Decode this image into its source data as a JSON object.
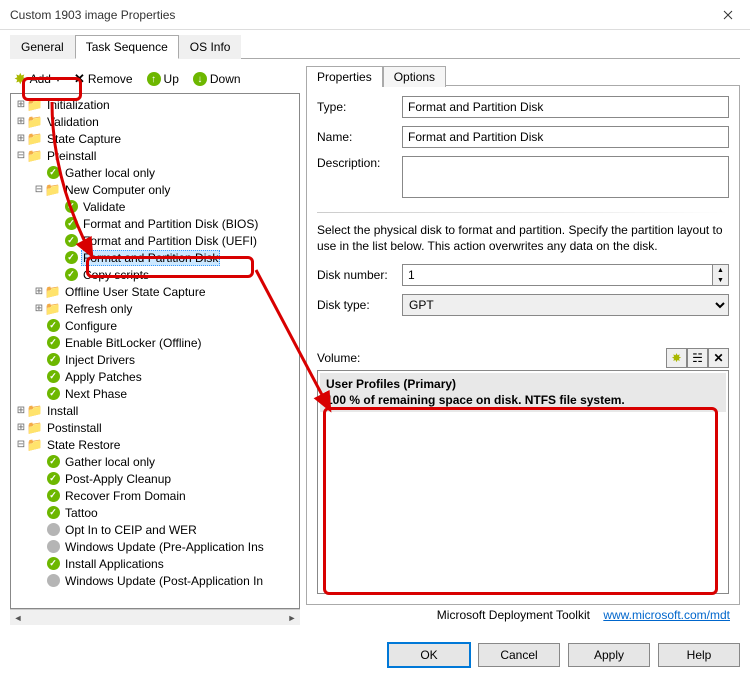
{
  "window": {
    "title": "Custom 1903 image Properties"
  },
  "outer_tabs": {
    "general": "General",
    "task_sequence": "Task Sequence",
    "os_info": "OS Info"
  },
  "toolbar": {
    "add": "Add",
    "remove": "Remove",
    "up": "Up",
    "down": "Down"
  },
  "tree": [
    {
      "d": 0,
      "t": "twf",
      "l": "Initialization"
    },
    {
      "d": 0,
      "t": "twf",
      "l": "Validation"
    },
    {
      "d": 0,
      "t": "twf",
      "l": "State Capture"
    },
    {
      "d": 0,
      "t": "opf",
      "l": "Preinstall"
    },
    {
      "d": 1,
      "t": "cond",
      "l": "Gather local only"
    },
    {
      "d": 1,
      "t": "opf",
      "l": "New Computer only"
    },
    {
      "d": 2,
      "t": "chk",
      "l": "Validate"
    },
    {
      "d": 2,
      "t": "chk",
      "l": "Format and Partition Disk (BIOS)"
    },
    {
      "d": 2,
      "t": "chk",
      "l": "Format and Partition Disk (UEFI)"
    },
    {
      "d": 2,
      "t": "chk",
      "l": "Format and Partition Disk",
      "sel": true
    },
    {
      "d": 2,
      "t": "chk",
      "l": "Copy scripts"
    },
    {
      "d": 1,
      "t": "twf",
      "l": "Offline User State Capture"
    },
    {
      "d": 1,
      "t": "twf",
      "l": "Refresh only"
    },
    {
      "d": 1,
      "t": "chk",
      "l": "Configure"
    },
    {
      "d": 1,
      "t": "chk",
      "l": "Enable BitLocker (Offline)"
    },
    {
      "d": 1,
      "t": "chk",
      "l": "Inject Drivers"
    },
    {
      "d": 1,
      "t": "chk",
      "l": "Apply Patches"
    },
    {
      "d": 1,
      "t": "chk",
      "l": "Next Phase"
    },
    {
      "d": 0,
      "t": "twf",
      "l": "Install"
    },
    {
      "d": 0,
      "t": "twf",
      "l": "Postinstall"
    },
    {
      "d": 0,
      "t": "opf",
      "l": "State Restore"
    },
    {
      "d": 1,
      "t": "cond",
      "l": "Gather local only"
    },
    {
      "d": 1,
      "t": "chk",
      "l": "Post-Apply Cleanup"
    },
    {
      "d": 1,
      "t": "chk",
      "l": "Recover From Domain"
    },
    {
      "d": 1,
      "t": "chk",
      "l": "Tattoo"
    },
    {
      "d": 1,
      "t": "grey",
      "l": "Opt In to CEIP and WER"
    },
    {
      "d": 1,
      "t": "grey",
      "l": "Windows Update (Pre-Application Ins"
    },
    {
      "d": 1,
      "t": "chk",
      "l": "Install Applications"
    },
    {
      "d": 1,
      "t": "grey",
      "l": "Windows Update (Post-Application In"
    }
  ],
  "inner_tabs": {
    "properties": "Properties",
    "options": "Options"
  },
  "fields": {
    "type_lbl": "Type:",
    "type_val": "Format and Partition Disk",
    "name_lbl": "Name:",
    "name_val": "Format and Partition Disk",
    "desc_lbl": "Description:",
    "desc_val": "",
    "help": "Select the physical disk to format and partition.  Specify the partition layout to use in the list below.  This action overwrites any data on the disk.",
    "disknum_lbl": "Disk number:",
    "disknum_val": "1",
    "disktype_lbl": "Disk type:",
    "disktype_val": "GPT",
    "vol_lbl": "Volume:",
    "vol_name": "User Profiles (Primary)",
    "vol_desc": "100 % of remaining space on disk. NTFS file system."
  },
  "footer": {
    "brand": "Microsoft Deployment Toolkit",
    "link": "www.microsoft.com/mdt"
  },
  "buttons": {
    "ok": "OK",
    "cancel": "Cancel",
    "apply": "Apply",
    "help": "Help"
  }
}
